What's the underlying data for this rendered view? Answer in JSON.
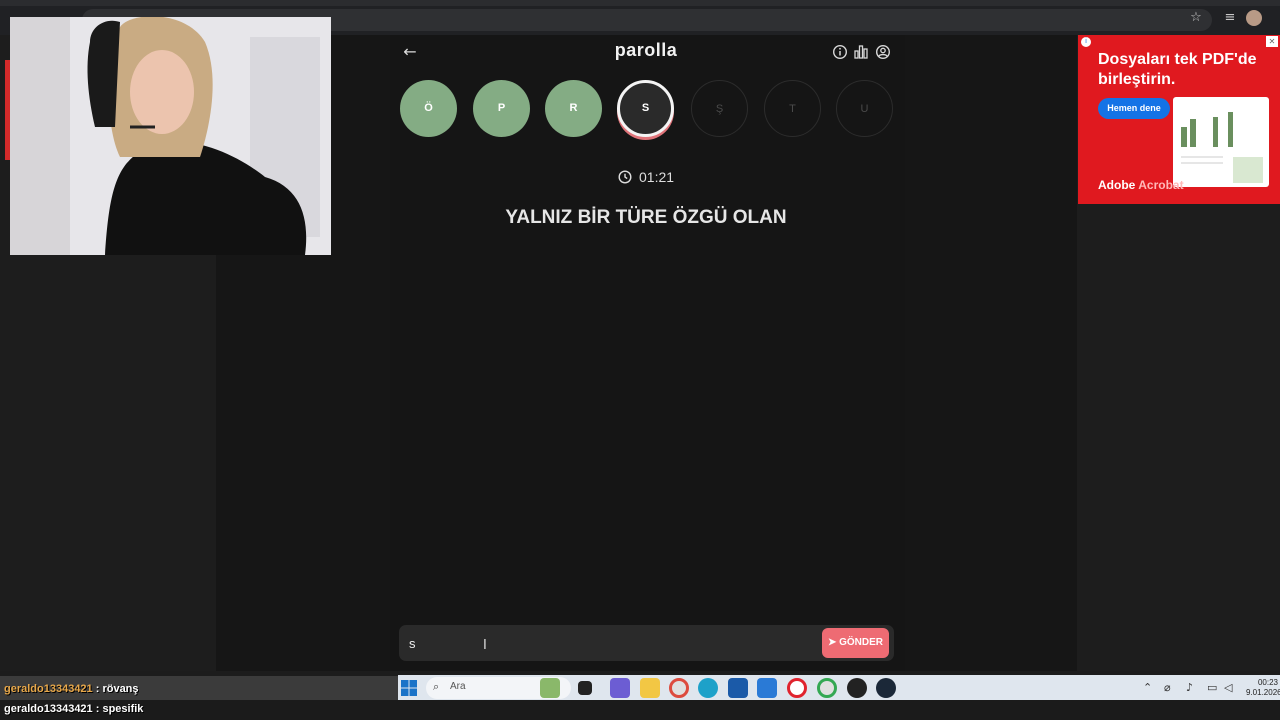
{
  "app": {
    "title": "parolla",
    "back_icon": "arrow-left-icon",
    "header_icons": [
      "info-icon",
      "stats-icon",
      "account-icon"
    ]
  },
  "letters": [
    {
      "char": "Ö",
      "state": "done"
    },
    {
      "char": "P",
      "state": "done"
    },
    {
      "char": "R",
      "state": "done"
    },
    {
      "char": "S",
      "state": "active"
    },
    {
      "char": "Ş",
      "state": "pending"
    },
    {
      "char": "T",
      "state": "pending"
    },
    {
      "char": "U",
      "state": "pending"
    }
  ],
  "timer": {
    "icon": "clock-icon",
    "value": "01:21"
  },
  "question": "YALNIZ BİR TÜRE ÖZGÜ OLAN",
  "answer": {
    "value": "s",
    "send_label": "GÖNDER",
    "send_icon": "send-icon"
  },
  "ad": {
    "headline": "Dosyaları tek PDF'de birleştirin.",
    "cta": "Hemen dene",
    "brand_1": "Adobe",
    "brand_2": "Acrobat",
    "close_icon": "close-icon",
    "info_icon": "ad-info-icon"
  },
  "chat": [
    {
      "user": "geraldo13343421",
      "message": " : rövanş"
    },
    {
      "user": "geraldo13343421",
      "message": " : spesifik"
    }
  ],
  "taskbar": {
    "search_placeholder": "Ara",
    "clock_time": "00:23",
    "clock_date": "9.01.2026"
  },
  "colors": {
    "done": "#84ac84",
    "active_ring": "#e0747a",
    "send": "#ee6b73",
    "ad_bg": "#e0191f"
  }
}
